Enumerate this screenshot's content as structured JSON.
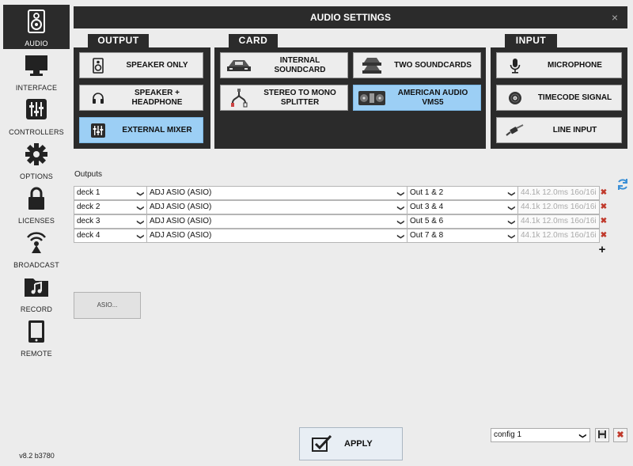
{
  "window": {
    "title": "AUDIO SETTINGS",
    "close_glyph": "×"
  },
  "sidebar": {
    "items": [
      {
        "label": "AUDIO",
        "icon": "speaker-icon",
        "active": true
      },
      {
        "label": "INTERFACE",
        "icon": "monitor-icon"
      },
      {
        "label": "CONTROLLERS",
        "icon": "mixer-icon"
      },
      {
        "label": "OPTIONS",
        "icon": "gear-icon"
      },
      {
        "label": "LICENSES",
        "icon": "lock-icon"
      },
      {
        "label": "BROADCAST",
        "icon": "broadcast-icon"
      },
      {
        "label": "RECORD",
        "icon": "music-folder-icon"
      },
      {
        "label": "REMOTE",
        "icon": "tablet-icon"
      }
    ],
    "version": "v8.2 b3780"
  },
  "output": {
    "tab": "OUTPUT",
    "buttons": [
      {
        "label": "SPEAKER ONLY",
        "icon": "speaker-icon"
      },
      {
        "label": "SPEAKER + HEADPHONE",
        "icon": "headphone-icon"
      },
      {
        "label": "EXTERNAL MIXER",
        "icon": "mixer-icon",
        "selected": true
      }
    ]
  },
  "card": {
    "tab": "CARD",
    "buttons": [
      {
        "label": "INTERNAL SOUNDCARD",
        "icon": "soundcard-icon"
      },
      {
        "label": "TWO SOUNDCARDS",
        "icon": "two-soundcards-icon"
      },
      {
        "label": "STEREO TO MONO SPLITTER",
        "icon": "splitter-cable-icon"
      },
      {
        "label": "AMERICAN AUDIO VMS5",
        "icon": "controller-icon",
        "selected": true
      }
    ]
  },
  "input": {
    "tab": "INPUT",
    "buttons": [
      {
        "label": "MICROPHONE",
        "icon": "microphone-icon"
      },
      {
        "label": "TIMECODE SIGNAL",
        "icon": "vinyl-icon"
      },
      {
        "label": "LINE INPUT",
        "icon": "cable-icon"
      }
    ]
  },
  "outputs": {
    "label": "Outputs",
    "rows": [
      {
        "deck": "deck 1",
        "device": "ADJ ASIO (ASIO)",
        "channels": "Out 1 & 2",
        "info": "44.1k 12.0ms 16o/16i"
      },
      {
        "deck": "deck 2",
        "device": "ADJ ASIO (ASIO)",
        "channels": "Out 3 & 4",
        "info": "44.1k 12.0ms 16o/16i"
      },
      {
        "deck": "deck 3",
        "device": "ADJ ASIO (ASIO)",
        "channels": "Out 5 & 6",
        "info": "44.1k 12.0ms 16o/16i"
      },
      {
        "deck": "deck 4",
        "device": "ADJ ASIO (ASIO)",
        "channels": "Out 7 & 8",
        "info": "44.1k 12.0ms 16o/16i"
      }
    ],
    "delete_glyph": "✖",
    "add_glyph": "+"
  },
  "asio_button": {
    "label": "ASIO..."
  },
  "apply_button": {
    "label": "APPLY"
  },
  "config": {
    "selected": "config 1",
    "delete_glyph": "✖"
  },
  "colors": {
    "dark": "#2b2b2b",
    "selected": "#9ccff5",
    "background": "#ececec",
    "delete": "#c0392b"
  }
}
